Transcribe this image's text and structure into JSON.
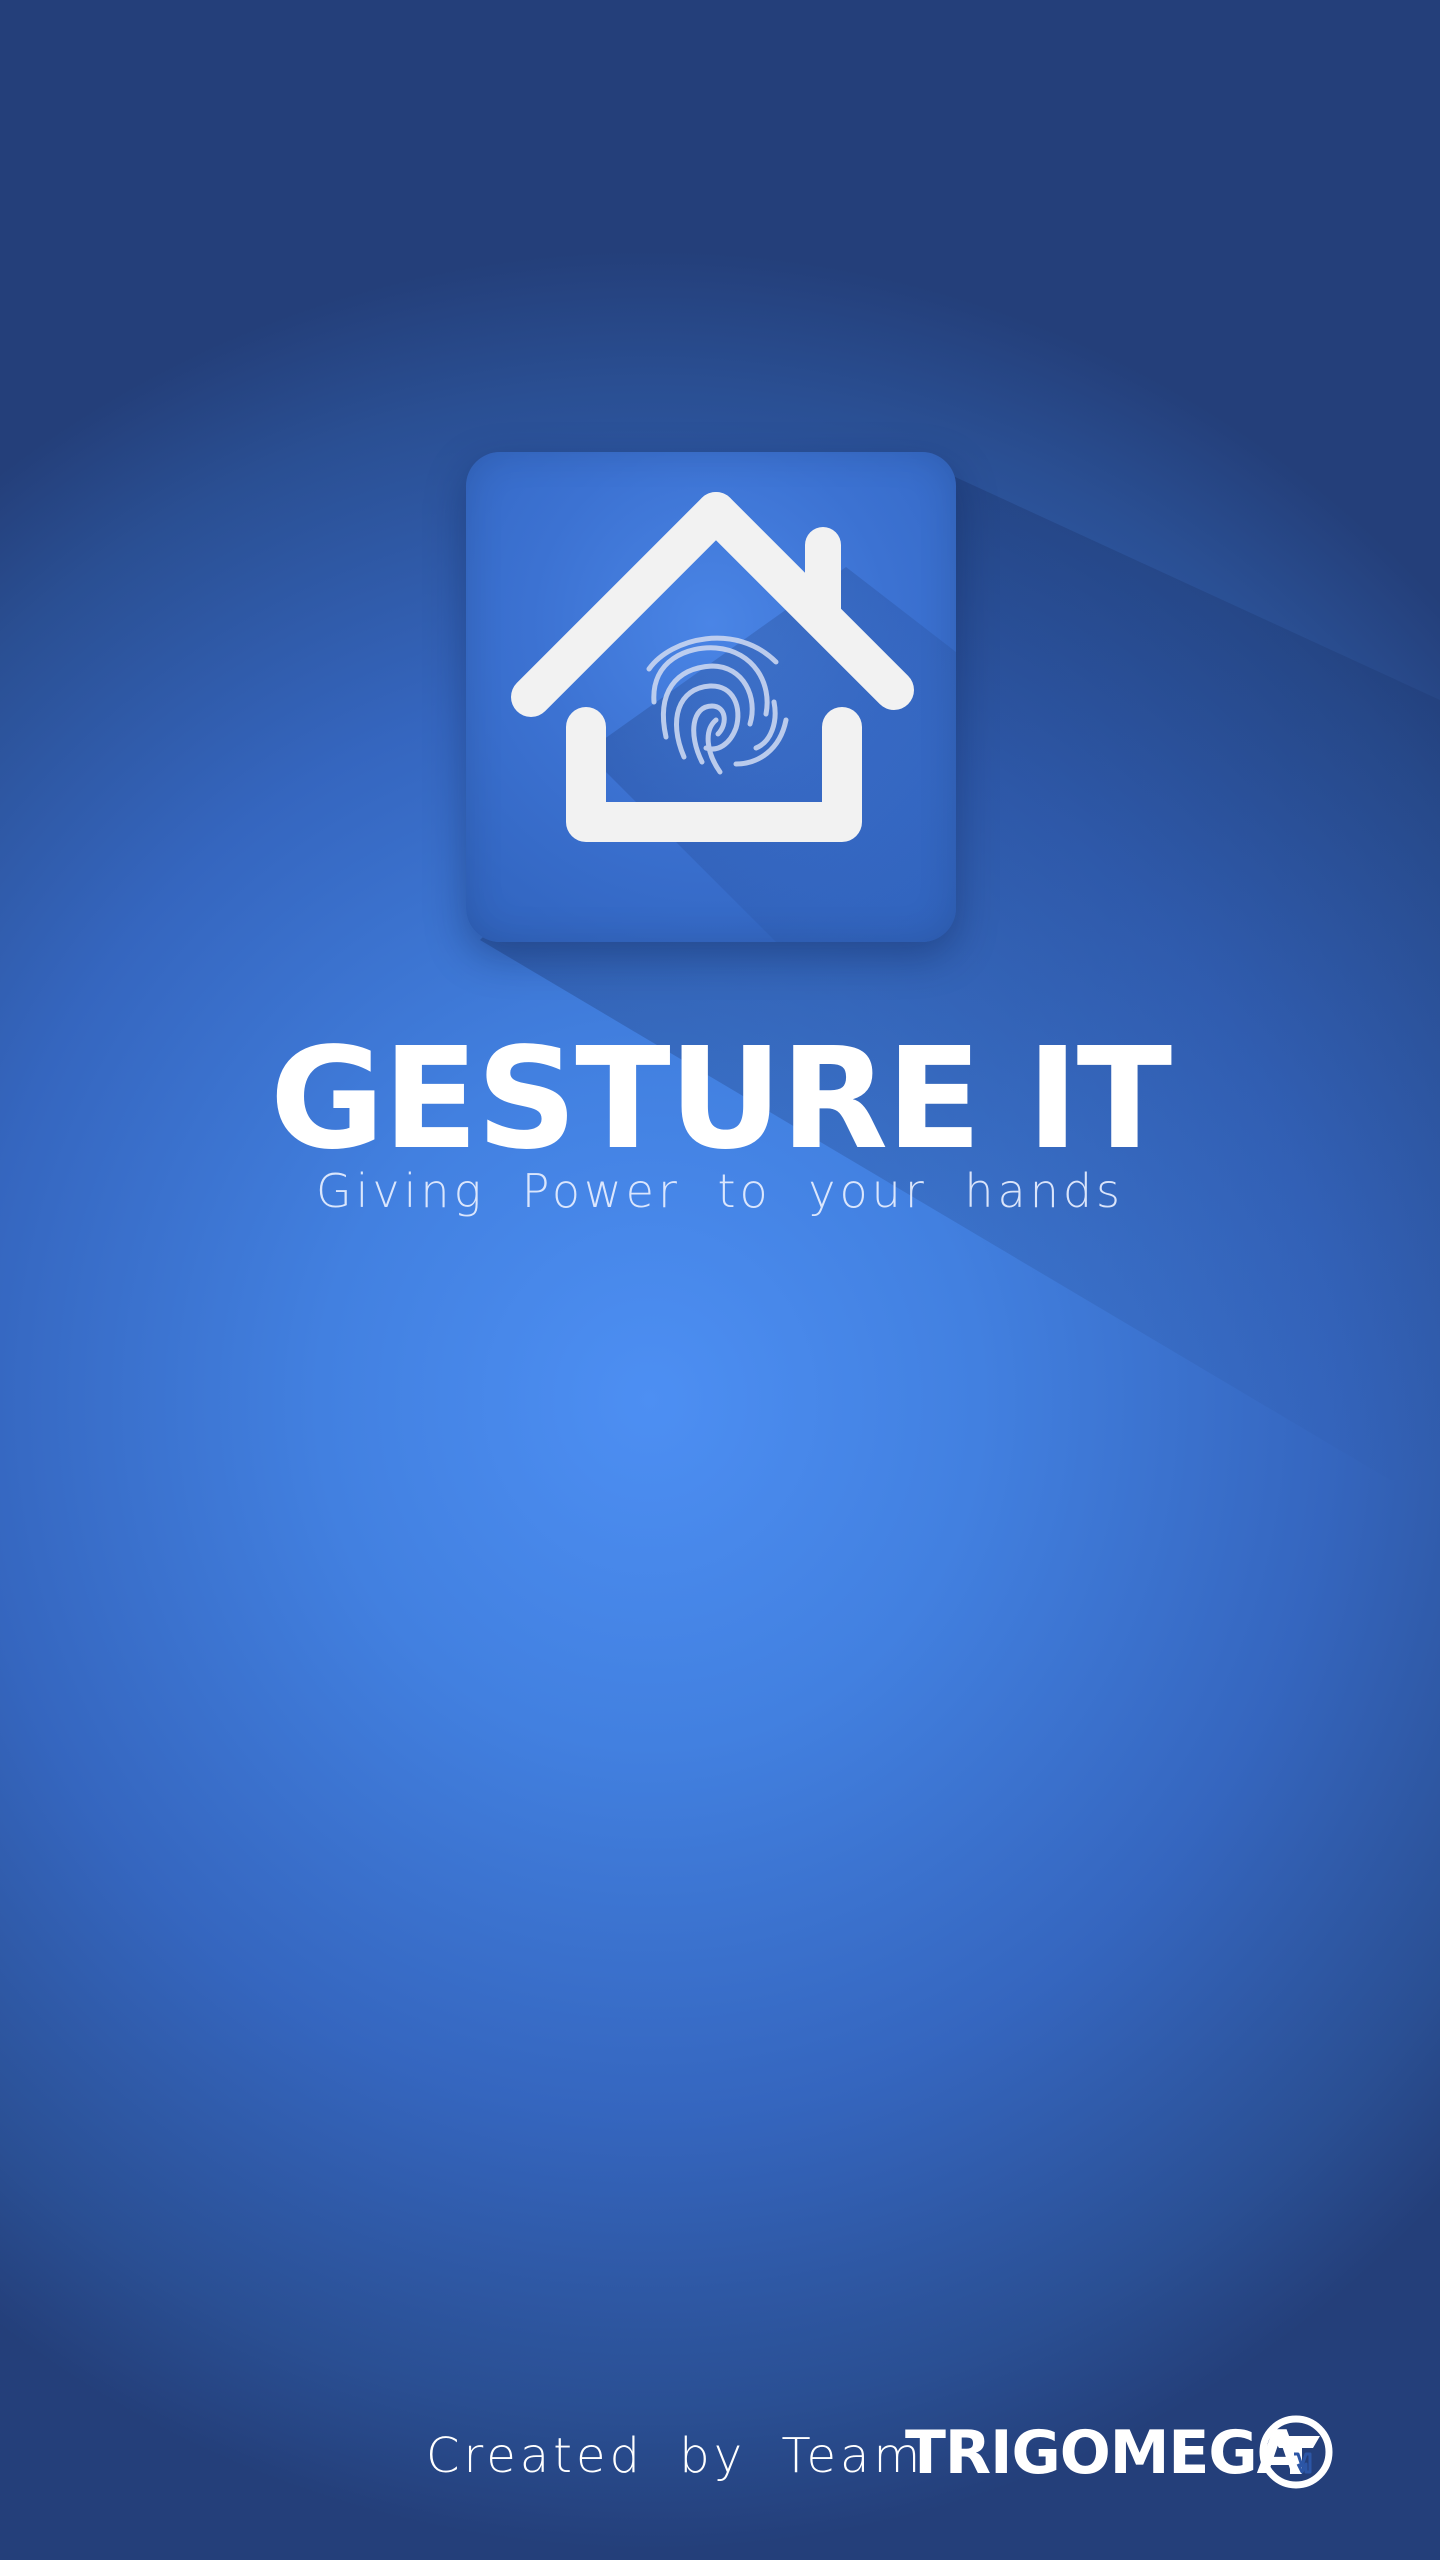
{
  "app": {
    "title": "GESTURE IT",
    "tagline": "Giving Power to your hands"
  },
  "footer": {
    "credit": "Created by Team",
    "brand": "TRIGOMEGA"
  },
  "icons": {
    "app_icon": "house-fingerprint-icon",
    "brand_logo": "trigomega-logo-icon"
  },
  "colors": {
    "background_center": "#4d8ff3",
    "background_edge": "#243f7a",
    "icon_tile": "#3c72d2",
    "foreground": "#ffffff"
  }
}
